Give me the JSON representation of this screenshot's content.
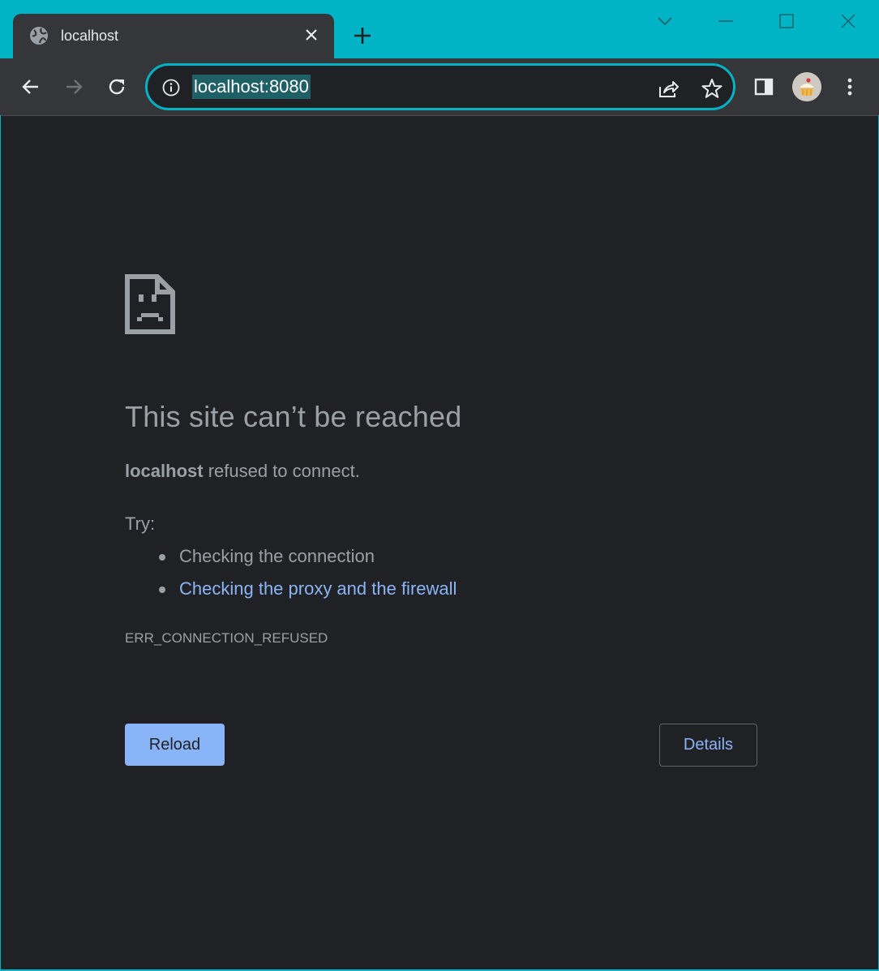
{
  "colors": {
    "frame": "#00b4c5",
    "toolbar": "#35363a",
    "page_bg": "#202124",
    "text_muted": "#9aa0a6",
    "link": "#8ab4f8",
    "primary_button": "#8ab4f8"
  },
  "tab": {
    "title": "localhost",
    "favicon": "globe-icon"
  },
  "toolbar": {
    "url": "localhost:8080",
    "icons": [
      "back-icon",
      "forward-icon",
      "reload-icon",
      "info-icon",
      "share-icon",
      "star-icon",
      "side-panel-icon",
      "avatar",
      "menu-icon"
    ]
  },
  "error_page": {
    "heading": "This site can’t be reached",
    "host": "localhost",
    "message": " refused to connect.",
    "try_label": "Try:",
    "suggestions": [
      "Checking the connection",
      "Checking the proxy and the firewall"
    ],
    "error_code": "ERR_CONNECTION_REFUSED",
    "reload_label": "Reload",
    "details_label": "Details"
  }
}
